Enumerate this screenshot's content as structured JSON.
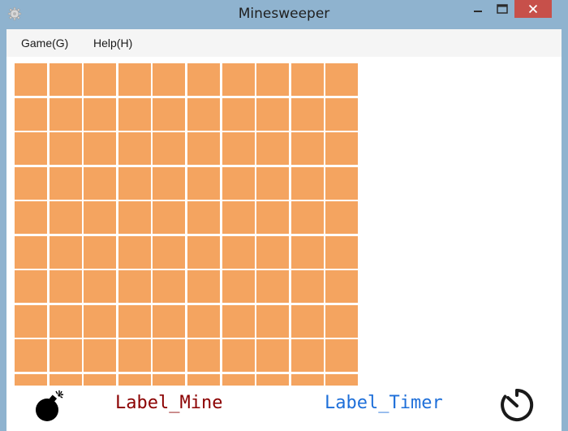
{
  "window": {
    "title": "Minesweeper",
    "icon": "gear-icon",
    "controls": [
      "minimize-icon",
      "maximize-icon",
      "close-icon"
    ],
    "close_color": "#c7504a"
  },
  "menubar": {
    "items": [
      {
        "label": "Game(G)"
      },
      {
        "label": "Help(H)"
      }
    ]
  },
  "board": {
    "columns": 10,
    "rows": 10,
    "cell_color": "#f4a460",
    "state": "all-covered"
  },
  "status": {
    "mine_icon": "bomb-icon",
    "mine_label": "Label_Mine",
    "mine_label_color": "#8b0000",
    "timer_label": "Label_Timer",
    "timer_label_color": "#1e6fd9",
    "timer_icon": "stopwatch-icon"
  }
}
